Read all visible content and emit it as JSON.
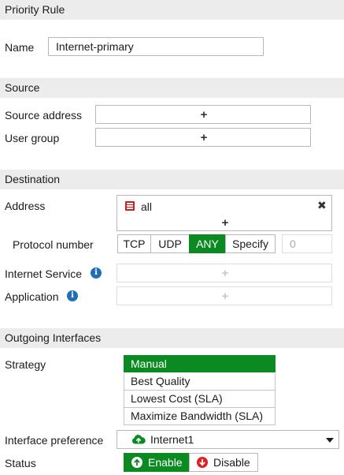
{
  "priority_rule": {
    "header": "Priority Rule",
    "name_label": "Name",
    "name_value": "Internet-primary"
  },
  "source": {
    "header": "Source",
    "address_label": "Source address",
    "user_group_label": "User group",
    "add_symbol": "+"
  },
  "destination": {
    "header": "Destination",
    "address_label": "Address",
    "address_entries": [
      {
        "label": "all",
        "icon": "address-object-icon"
      }
    ],
    "remove_symbol": "✖",
    "add_symbol": "+",
    "protocol_label": "Protocol number",
    "protocol_options": [
      "TCP",
      "UDP",
      "ANY",
      "Specify"
    ],
    "protocol_selected": "ANY",
    "protocol_value_placeholder": "0",
    "internet_service_label": "Internet Service",
    "application_label": "Application",
    "info_symbol": "i"
  },
  "outgoing": {
    "header": "Outgoing Interfaces",
    "strategy_label": "Strategy",
    "strategy_options": [
      "Manual",
      "Best Quality",
      "Lowest Cost (SLA)",
      "Maximize Bandwidth (SLA)"
    ],
    "strategy_selected": "Manual",
    "interface_pref_label": "Interface preference",
    "interface_pref_value": "Internet1",
    "interface_icon": "cloud-up-icon",
    "status_label": "Status",
    "enable_label": "Enable",
    "disable_label": "Disable",
    "status_selected": "Enable"
  },
  "colors": {
    "accent_green": "#0b8a21",
    "section_bg": "#ececec",
    "info_blue": "#1f6fb5",
    "danger_red": "#e02020"
  }
}
